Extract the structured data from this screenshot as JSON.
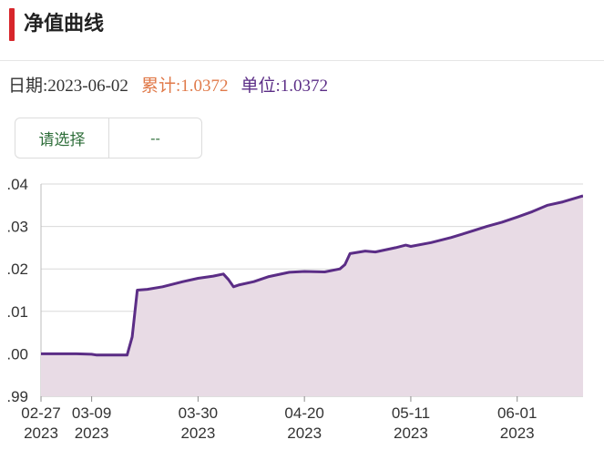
{
  "header": {
    "title": "净值曲线"
  },
  "info": {
    "date": "日期:2023-06-02",
    "cumulative": "累计:1.0372",
    "unit": "单位:1.0372"
  },
  "selector": {
    "label": "请选择",
    "value": "--"
  },
  "colors": {
    "accent": "#d7262b",
    "line": "#5b2d86",
    "fill": "#e8dbe5",
    "cumulative": "#e07a4a",
    "selector_text": "#2e6e3a"
  },
  "chart_data": {
    "type": "area",
    "title": "",
    "xlabel": "",
    "ylabel": "",
    "ylim": [
      0.99,
      1.04
    ],
    "yticks": [
      {
        "value": 1.04,
        "label": ".04"
      },
      {
        "value": 1.03,
        "label": ".03"
      },
      {
        "value": 1.02,
        "label": ".02"
      },
      {
        "value": 1.01,
        "label": ".01"
      },
      {
        "value": 1.0,
        "label": ".00"
      },
      {
        "value": 0.99,
        "label": ".99"
      }
    ],
    "xticks": [
      {
        "date": "2023-02-27",
        "line1": "02-27",
        "line2": "2023"
      },
      {
        "date": "2023-03-09",
        "line1": "03-09",
        "line2": "2023"
      },
      {
        "date": "2023-03-30",
        "line1": "03-30",
        "line2": "2023"
      },
      {
        "date": "2023-04-20",
        "line1": "04-20",
        "line2": "2023"
      },
      {
        "date": "2023-05-11",
        "line1": "05-11",
        "line2": "2023"
      },
      {
        "date": "2023-06-01",
        "line1": "06-01",
        "line2": "2023"
      }
    ],
    "grid": true,
    "series": [
      {
        "points": [
          [
            "2023-02-27",
            1.0
          ],
          [
            "2023-03-02",
            1.0
          ],
          [
            "2023-03-06",
            1.0
          ],
          [
            "2023-03-09",
            0.9999
          ],
          [
            "2023-03-10",
            0.9997
          ],
          [
            "2023-03-14",
            0.9997
          ],
          [
            "2023-03-16",
            0.9997
          ],
          [
            "2023-03-17",
            1.004
          ],
          [
            "2023-03-18",
            1.015
          ],
          [
            "2023-03-20",
            1.0152
          ],
          [
            "2023-03-23",
            1.0158
          ],
          [
            "2023-03-27",
            1.017
          ],
          [
            "2023-03-30",
            1.0178
          ],
          [
            "2023-04-02",
            1.0183
          ],
          [
            "2023-04-04",
            1.0188
          ],
          [
            "2023-04-05",
            1.0175
          ],
          [
            "2023-04-06",
            1.0158
          ],
          [
            "2023-04-07",
            1.0162
          ],
          [
            "2023-04-10",
            1.017
          ],
          [
            "2023-04-13",
            1.0182
          ],
          [
            "2023-04-17",
            1.0192
          ],
          [
            "2023-04-20",
            1.0194
          ],
          [
            "2023-04-24",
            1.0193
          ],
          [
            "2023-04-27",
            1.02
          ],
          [
            "2023-04-28",
            1.021
          ],
          [
            "2023-04-29",
            1.0236
          ],
          [
            "2023-05-02",
            1.0242
          ],
          [
            "2023-05-04",
            1.024
          ],
          [
            "2023-05-08",
            1.025
          ],
          [
            "2023-05-10",
            1.0256
          ],
          [
            "2023-05-11",
            1.0253
          ],
          [
            "2023-05-15",
            1.0262
          ],
          [
            "2023-05-19",
            1.0274
          ],
          [
            "2023-05-22",
            1.0285
          ],
          [
            "2023-05-26",
            1.03
          ],
          [
            "2023-05-29",
            1.031
          ],
          [
            "2023-06-01",
            1.0322
          ],
          [
            "2023-06-04",
            1.0335
          ],
          [
            "2023-06-07",
            1.035
          ],
          [
            "2023-06-10",
            1.0358
          ],
          [
            "2023-06-14",
            1.0372
          ]
        ]
      }
    ]
  }
}
